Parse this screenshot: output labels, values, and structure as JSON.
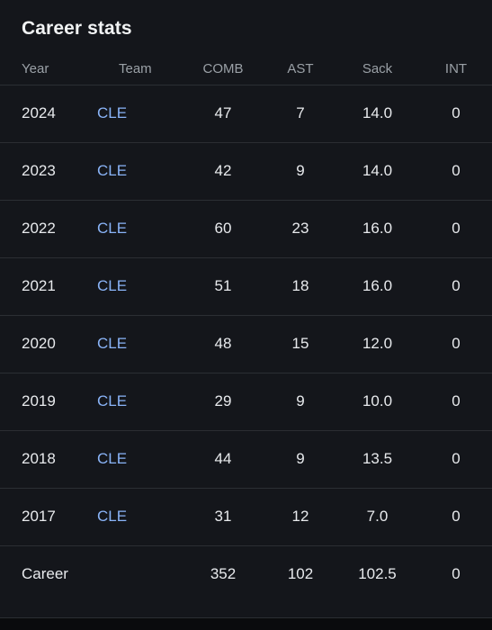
{
  "card": {
    "title": "Career stats"
  },
  "table": {
    "columns": [
      {
        "key": "year",
        "label": "Year",
        "align": "left"
      },
      {
        "key": "team",
        "label": "Team",
        "align": "left"
      },
      {
        "key": "comb",
        "label": "COMB",
        "align": "center"
      },
      {
        "key": "ast",
        "label": "AST",
        "align": "center"
      },
      {
        "key": "sack",
        "label": "Sack",
        "align": "center"
      },
      {
        "key": "int",
        "label": "INT",
        "align": "center"
      }
    ],
    "rows": [
      {
        "year": "2024",
        "team": "CLE",
        "comb": "47",
        "ast": "7",
        "sack": "14.0",
        "int": "0"
      },
      {
        "year": "2023",
        "team": "CLE",
        "comb": "42",
        "ast": "9",
        "sack": "14.0",
        "int": "0"
      },
      {
        "year": "2022",
        "team": "CLE",
        "comb": "60",
        "ast": "23",
        "sack": "16.0",
        "int": "0"
      },
      {
        "year": "2021",
        "team": "CLE",
        "comb": "51",
        "ast": "18",
        "sack": "16.0",
        "int": "0"
      },
      {
        "year": "2020",
        "team": "CLE",
        "comb": "48",
        "ast": "15",
        "sack": "12.0",
        "int": "0"
      },
      {
        "year": "2019",
        "team": "CLE",
        "comb": "29",
        "ast": "9",
        "sack": "10.0",
        "int": "0"
      },
      {
        "year": "2018",
        "team": "CLE",
        "comb": "44",
        "ast": "9",
        "sack": "13.5",
        "int": "0"
      },
      {
        "year": "2017",
        "team": "CLE",
        "comb": "31",
        "ast": "12",
        "sack": "7.0",
        "int": "0"
      },
      {
        "year": "Career",
        "team": "",
        "comb": "352",
        "ast": "102",
        "sack": "102.5",
        "int": "0"
      }
    ]
  },
  "colors": {
    "background": "#14161b",
    "page_background": "#0e1013",
    "divider": "#2b2e33",
    "text_primary": "#e8eaed",
    "text_secondary": "#9aa0a6",
    "link": "#8ab4f8"
  }
}
